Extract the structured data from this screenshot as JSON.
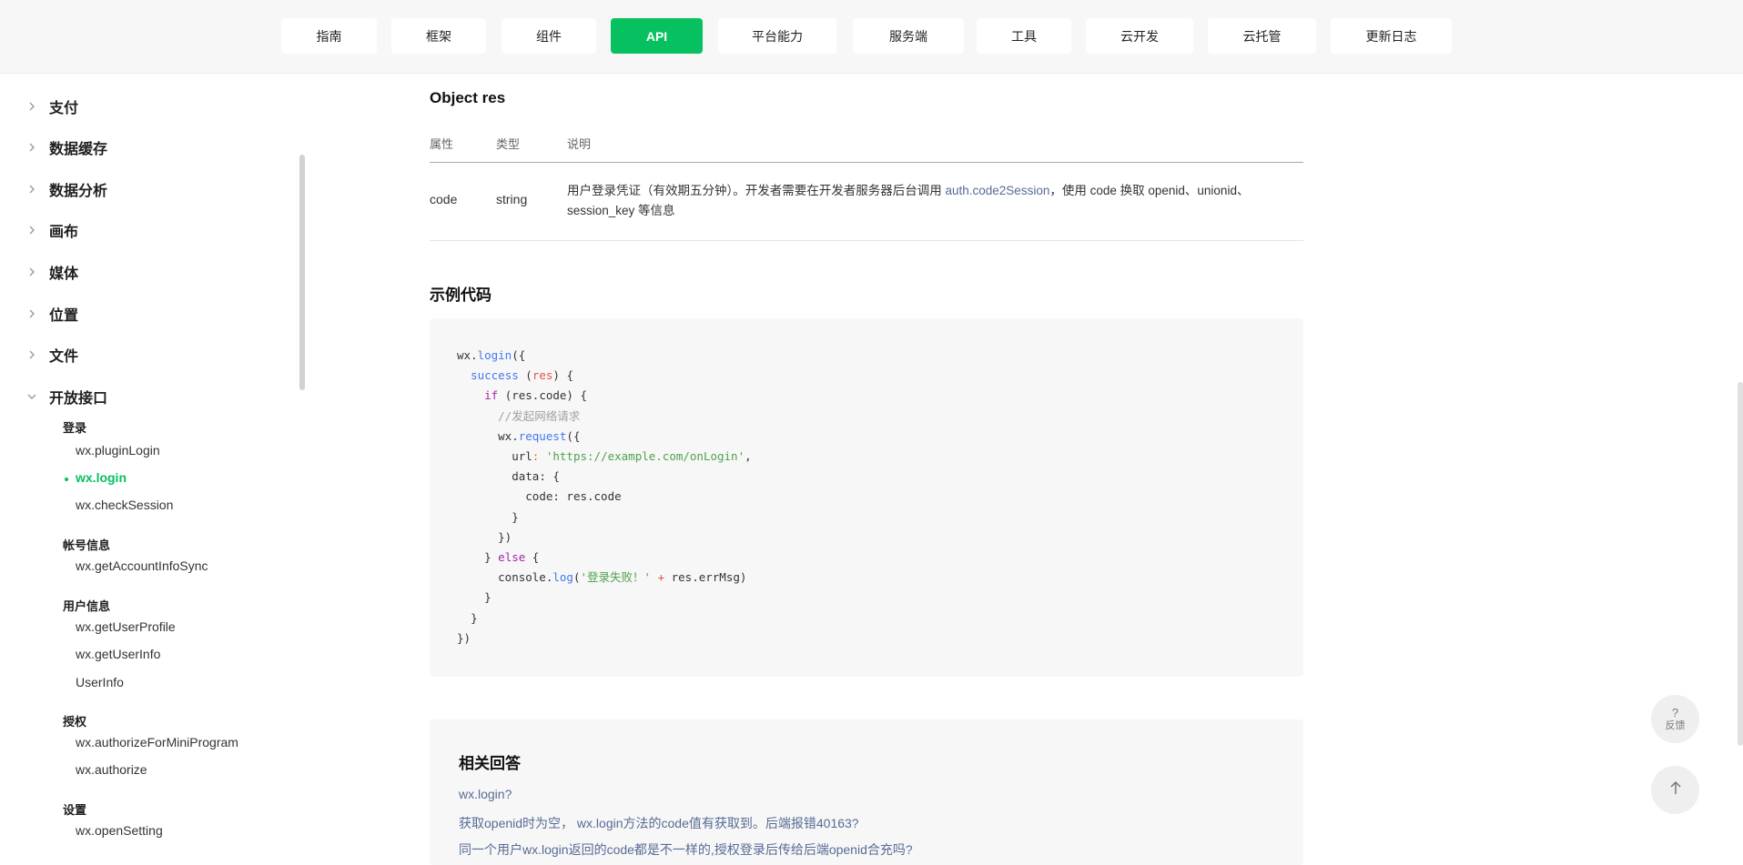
{
  "nav": {
    "items": [
      {
        "label": "指南",
        "left": 0
      },
      {
        "label": "框架"
      },
      {
        "label": "组件"
      },
      {
        "label": "API"
      },
      {
        "label": "平台能力"
      },
      {
        "label": "服务端"
      },
      {
        "label": "工具"
      },
      {
        "label": "云开发"
      },
      {
        "label": "云托管"
      },
      {
        "label": "更新日志"
      }
    ],
    "active": "API"
  },
  "sidebar": {
    "categories": [
      "支付",
      "数据缓存",
      "数据分析",
      "画布",
      "媒体",
      "位置",
      "文件",
      "开放接口"
    ],
    "groups": {
      "login": {
        "label": "登录",
        "items": [
          "wx.pluginLogin",
          "wx.login",
          "wx.checkSession"
        ]
      },
      "account": {
        "label": "帐号信息",
        "items": [
          "wx.getAccountInfoSync"
        ]
      },
      "userinfo": {
        "label": "用户信息",
        "items": [
          "wx.getUserProfile",
          "wx.getUserInfo",
          "UserInfo"
        ]
      },
      "auth": {
        "label": "授权",
        "items": [
          "wx.authorizeForMiniProgram",
          "wx.authorize"
        ]
      },
      "settings": {
        "label": "设置",
        "items": [
          "wx.openSetting"
        ]
      }
    }
  },
  "content": {
    "object_title": "Object res",
    "table": {
      "headers": [
        "属性",
        "类型",
        "说明"
      ],
      "rows": [
        {
          "name": "code",
          "type": "string",
          "desc_before": "用户登录凭证（有效期五分钟）。开发者需要在开发者服务器后台调用 ",
          "desc_link": "auth.code2Session",
          "desc_after": "，使用 code 换取 openid、unionid、session_key 等信息"
        }
      ]
    },
    "example_title": "示例代码",
    "code": {
      "l1_obj": "wx.",
      "l1_fn": "login",
      "l1_rest": "({",
      "l2_key": "success",
      "l2_a": " (",
      "l2_param": "res",
      "l2_b": ") {",
      "l3_kw": "if",
      "l3_rest": " (res.code) {",
      "l4_comment": "//发起网络请求",
      "l5_obj": "wx.",
      "l5_fn": "request",
      "l5_rest": "({",
      "l6_key": "url",
      "l6_colon": ": ",
      "l6_str": "'https://example.com/onLogin'",
      "l6_comma": ",",
      "l7_key": "data",
      "l7_rest": ": {",
      "l8_key": "code",
      "l8_rest": ": res.code",
      "l9": "}",
      "l10": "})",
      "l11_a": "} ",
      "l11_kw": "else",
      "l11_b": " {",
      "l12_obj": "console.",
      "l12_fn": "log",
      "l12_a": "(",
      "l12_str": "'登录失败！'",
      "l12_plus": " + ",
      "l12_rest": "res.errMsg)",
      "l13": "}",
      "l14": "}",
      "l15": "})"
    },
    "answers": {
      "title": "相关回答",
      "links": [
        "wx.login?",
        "获取openid时为空， wx.login方法的code值有获取到。后端报错40163?",
        "同一个用户wx.login返回的code都是不一样的,授权登录后传给后端openid合充吗?"
      ]
    }
  },
  "float": {
    "feedback_q": "?",
    "feedback_label": "反馈"
  }
}
